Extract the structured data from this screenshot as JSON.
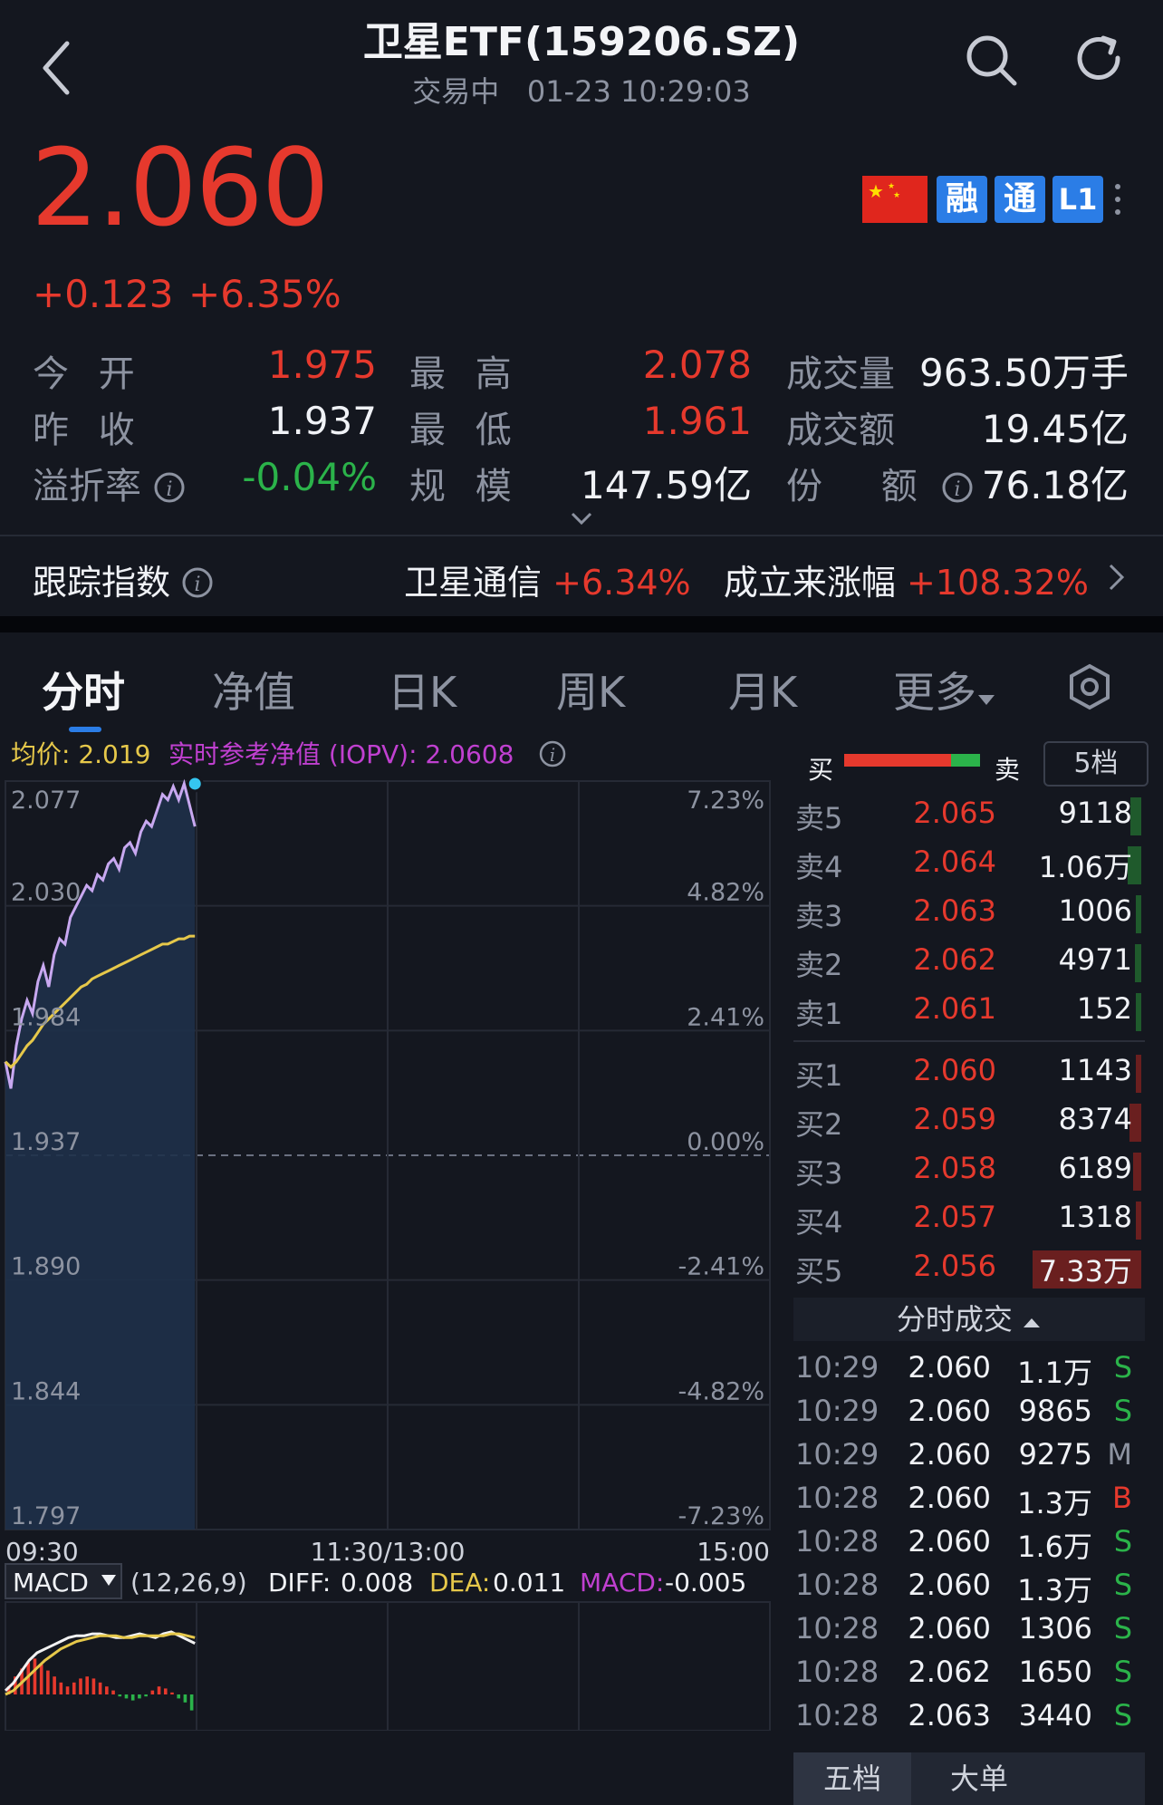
{
  "header": {
    "title": "卫星ETF(159206.SZ)",
    "status": "交易中",
    "datetime": "01-23 10:29:03"
  },
  "quote": {
    "price": "2.060",
    "change": "+0.123",
    "change_pct": "+6.35%"
  },
  "badges": {
    "rong": "融",
    "tong": "通",
    "level": "L1"
  },
  "stats": {
    "open_label": "今 开",
    "open": "1.975",
    "high_label": "最 高",
    "high": "2.078",
    "volume_label": "成交量",
    "volume": "963.50万手",
    "prev_close_label": "昨 收",
    "prev_close": "1.937",
    "low_label": "最 低",
    "low": "1.961",
    "amount_label": "成交额",
    "amount": "19.45亿",
    "premium_label": "溢折率",
    "premium": "-0.04%",
    "scale_label": "规 模",
    "scale": "147.59亿",
    "shares_label": "份 额",
    "shares": "76.18亿"
  },
  "tracking": {
    "label": "跟踪指数",
    "index_name": "卫星通信",
    "index_change": "+6.34%",
    "since_label": "成立来涨幅",
    "since_change": "+108.32%"
  },
  "tabs": [
    "分时",
    "净值",
    "日K",
    "周K",
    "月K",
    "更多"
  ],
  "chart_info": {
    "avg_label": "均价: 2.019",
    "iopv_label": "实时参考净值 (IOPV): 2.0608"
  },
  "chart_data": {
    "type": "line",
    "y_price_ticks": [
      "2.077",
      "2.030",
      "1.984",
      "1.937",
      "1.890",
      "1.844",
      "1.797"
    ],
    "y_pct_ticks": [
      "7.23%",
      "4.82%",
      "2.41%",
      "0.00%",
      "-2.41%",
      "-4.82%",
      "-7.23%"
    ],
    "x_ticks": [
      "09:30",
      "11:30/13:00",
      "15:00"
    ],
    "ylim": [
      1.797,
      2.077
    ],
    "prev_close": 1.937,
    "series": [
      {
        "values": [
          1.972,
          1.962,
          1.978,
          1.988,
          1.995,
          1.99,
          2.002,
          2.008,
          2.0,
          2.012,
          2.018,
          2.016,
          2.026,
          2.03,
          2.034,
          2.038,
          2.036,
          2.042,
          2.04,
          2.046,
          2.048,
          2.044,
          2.052,
          2.054,
          2.05,
          2.058,
          2.062,
          2.06,
          2.066,
          2.072,
          2.07,
          2.075,
          2.07,
          2.076,
          2.068,
          2.06
        ]
      },
      {
        "values": [
          1.972,
          1.97,
          1.972,
          1.975,
          1.978,
          1.98,
          1.983,
          1.986,
          1.988,
          1.99,
          1.992,
          1.994,
          1.996,
          1.998,
          2.0,
          2.001,
          2.003,
          2.004,
          2.005,
          2.006,
          2.007,
          2.008,
          2.009,
          2.01,
          2.011,
          2.012,
          2.013,
          2.014,
          2.015,
          2.016,
          2.016,
          2.017,
          2.018,
          2.018,
          2.019,
          2.019
        ]
      }
    ]
  },
  "macd": {
    "label": "MACD",
    "params": "(12,26,9)",
    "diff_label": "DIFF:",
    "diff": "0.008",
    "dea_label": "DEA:",
    "dea": "0.011",
    "macd_label": "MACD:",
    "macd": "-0.005",
    "bars": [
      0.004,
      0.009,
      0.013,
      0.016,
      0.018,
      0.015,
      0.012,
      0.009,
      0.006,
      0.004,
      0.006,
      0.008,
      0.009,
      0.008,
      0.006,
      0.004,
      0.002,
      -0.001,
      -0.002,
      -0.003,
      -0.002,
      -0.001,
      0.002,
      0.004,
      0.003,
      0.001,
      -0.002,
      -0.004,
      -0.008
    ],
    "diff_line": [
      0.002,
      0.006,
      0.012,
      0.018,
      0.022,
      0.024,
      0.026,
      0.028,
      0.03,
      0.031,
      0.031,
      0.032,
      0.032,
      0.031,
      0.03,
      0.03,
      0.031,
      0.032,
      0.031,
      0.03,
      0.032,
      0.033,
      0.031,
      0.029,
      0.027
    ],
    "dea_line": [
      0.0,
      0.002,
      0.006,
      0.01,
      0.014,
      0.018,
      0.021,
      0.024,
      0.026,
      0.028,
      0.029,
      0.03,
      0.031,
      0.031,
      0.031,
      0.03,
      0.03,
      0.031,
      0.031,
      0.031,
      0.031,
      0.032,
      0.032,
      0.031,
      0.03
    ]
  },
  "orderbook": {
    "buy_label": "买",
    "sell_label": "卖",
    "levels_btn": "5档",
    "asks": [
      {
        "label": "卖5",
        "price": "2.065",
        "vol": "9118"
      },
      {
        "label": "卖4",
        "price": "2.064",
        "vol": "1.06万"
      },
      {
        "label": "卖3",
        "price": "2.063",
        "vol": "1006"
      },
      {
        "label": "卖2",
        "price": "2.062",
        "vol": "4971"
      },
      {
        "label": "卖1",
        "price": "2.061",
        "vol": "152"
      }
    ],
    "bids": [
      {
        "label": "买1",
        "price": "2.060",
        "vol": "1143"
      },
      {
        "label": "买2",
        "price": "2.059",
        "vol": "8374"
      },
      {
        "label": "买3",
        "price": "2.058",
        "vol": "6189"
      },
      {
        "label": "买4",
        "price": "2.057",
        "vol": "1318"
      },
      {
        "label": "买5",
        "price": "2.056",
        "vol": "7.33万"
      }
    ]
  },
  "ticks_panel": {
    "header": "分时成交",
    "rows": [
      {
        "time": "10:29",
        "price": "2.060",
        "vol": "1.1万",
        "side": "S"
      },
      {
        "time": "10:29",
        "price": "2.060",
        "vol": "9865",
        "side": "S"
      },
      {
        "time": "10:29",
        "price": "2.060",
        "vol": "9275",
        "side": "M"
      },
      {
        "time": "10:28",
        "price": "2.060",
        "vol": "1.3万",
        "side": "B"
      },
      {
        "time": "10:28",
        "price": "2.060",
        "vol": "1.6万",
        "side": "S"
      },
      {
        "time": "10:28",
        "price": "2.060",
        "vol": "1.3万",
        "side": "S"
      },
      {
        "time": "10:28",
        "price": "2.060",
        "vol": "1306",
        "side": "S"
      },
      {
        "time": "10:28",
        "price": "2.062",
        "vol": "1650",
        "side": "S"
      },
      {
        "time": "10:28",
        "price": "2.063",
        "vol": "3440",
        "side": "S"
      }
    ],
    "bottom_tabs": [
      "五档",
      "大单"
    ]
  },
  "colors": {
    "up": "#e6392d",
    "down": "#2bb34a",
    "accent": "#2b7de6",
    "avg_line": "#e6c84a",
    "iopv": "#c040d0"
  }
}
